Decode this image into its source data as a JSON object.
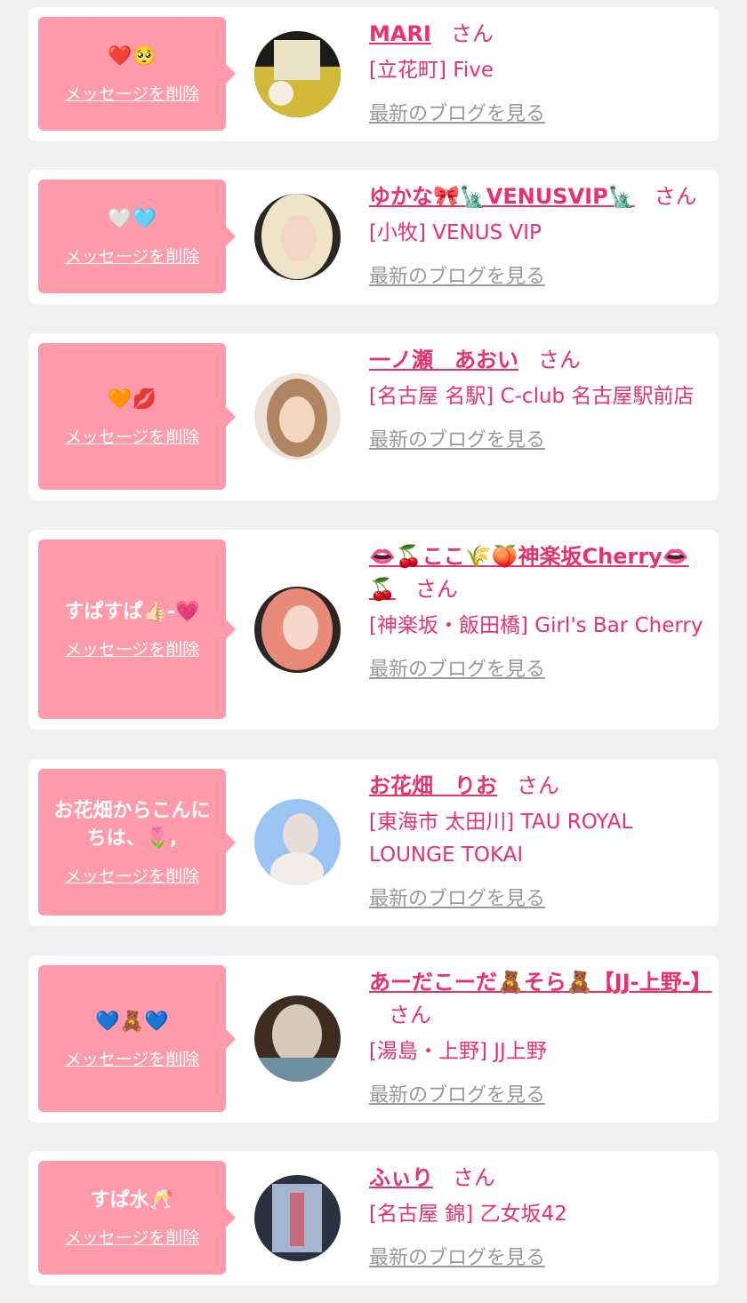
{
  "items": [
    {
      "message": "❤️🥺",
      "delete_label": "メッセージを削除",
      "name": "MARI",
      "honorific": "さん",
      "shop": "[立花町] Five",
      "blog_link": "最新のブログを見る",
      "avatar_colors": [
        "#1d1c16",
        "#d2b93a"
      ]
    },
    {
      "message": "🤍🩵",
      "delete_label": "メッセージを削除",
      "name": "ゆかな🎀🗽VENUSVIP🗽",
      "honorific": "さん",
      "shop": "[小牧] VENUS VIP",
      "blog_link": "最新のブログを見る",
      "avatar_colors": [
        "#efe4c9",
        "#2a2622"
      ]
    },
    {
      "message": "🧡💋",
      "delete_label": "メッセージを削除",
      "name": "一ノ瀬　あおい",
      "honorific": "さん",
      "shop": "[名古屋 名駅] C-club 名古屋駅前店",
      "blog_link": "最新のブログを見る",
      "avatar_colors": [
        "#b08564",
        "#ece2d7"
      ]
    },
    {
      "message": "すぱすぱ👍🏻-💗",
      "delete_label": "メッセージを削除",
      "name": "👄🍒ここ🌾🍑神楽坂Cherry👄🍒",
      "honorific": "さん",
      "shop": "[神楽坂・飯田橋] Girl's Bar Cherry",
      "blog_link": "最新のブログを見る",
      "avatar_colors": [
        "#e88a7a",
        "#2b2523"
      ]
    },
    {
      "message": "お花畑からこんにちは、🌷,",
      "delete_label": "メッセージを削除",
      "name": "お花畑　りお",
      "honorific": "さん",
      "shop": "[東海市 太田川] TAU ROYAL LOUNGE TOKAI",
      "blog_link": "最新のブログを見る",
      "avatar_colors": [
        "#9cc4f2",
        "#e9ddd8"
      ]
    },
    {
      "message": "💙🧸💙",
      "delete_label": "メッセージを削除",
      "name": "あーだこーだ🧸そら🧸【JJ-上野-】",
      "honorific": "さん",
      "shop": "[湯島・上野] JJ上野",
      "blog_link": "最新のブログを見る",
      "avatar_colors": [
        "#d8c8b8",
        "#3d2c1f"
      ]
    },
    {
      "message": "すぱ水🥂",
      "delete_label": "メッセージを削除",
      "name": "ふぃり",
      "honorific": "さん",
      "shop": "[名古屋 錦] 乙女坂42",
      "blog_link": "最新のブログを見る",
      "avatar_colors": [
        "#2b3140",
        "#a4b6cf"
      ]
    }
  ]
}
